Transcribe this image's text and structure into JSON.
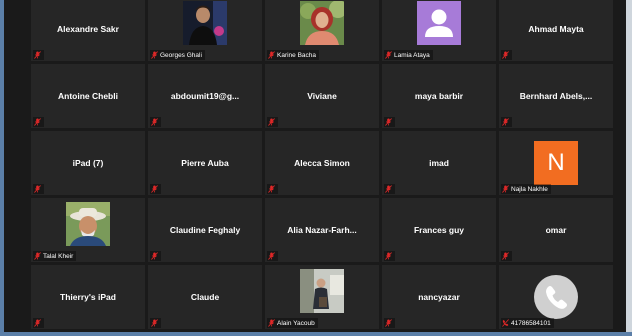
{
  "icons": {
    "mute": "mic-muted-icon",
    "phone": "phone-icon",
    "default_avatar": "person-silhouette-icon"
  },
  "colors": {
    "tile_bg": "#262626",
    "window_bg": "#1a1a1a",
    "mute_red": "#e02828",
    "initial_avatar": "#f26d21",
    "default_avatar": "#a77bd8"
  },
  "participants": [
    {
      "name": "Alexandre Sakr",
      "label": ""
    },
    {
      "name": "",
      "label": "Georges Ghali"
    },
    {
      "name": "",
      "label": "Karine Bacha"
    },
    {
      "name": "",
      "label": "Lamia Ataya"
    },
    {
      "name": "Ahmad Mayta",
      "label": ""
    },
    {
      "name": "Antoine Chebli",
      "label": ""
    },
    {
      "name": "abdoumit19@g...",
      "label": ""
    },
    {
      "name": "Viviane",
      "label": ""
    },
    {
      "name": "maya barbir",
      "label": ""
    },
    {
      "name": "Bernhard  Abels,...",
      "label": ""
    },
    {
      "name": "iPad (7)",
      "label": ""
    },
    {
      "name": "Pierre Auba",
      "label": ""
    },
    {
      "name": "Alecca Simon",
      "label": ""
    },
    {
      "name": "imad",
      "label": ""
    },
    {
      "name": "",
      "label": "Najla Nakhle",
      "initial": "N"
    },
    {
      "name": "",
      "label": "Talal Kheir"
    },
    {
      "name": "Claudine Feghaly",
      "label": ""
    },
    {
      "name": "Alia  Nazar-Farh...",
      "label": ""
    },
    {
      "name": "Frances guy",
      "label": ""
    },
    {
      "name": "omar",
      "label": ""
    },
    {
      "name": "Thierry's iPad",
      "label": ""
    },
    {
      "name": "Claude",
      "label": ""
    },
    {
      "name": "",
      "label": "Alain Yacoub"
    },
    {
      "name": "nancyazar",
      "label": ""
    },
    {
      "name": "",
      "label": "41786584101"
    }
  ]
}
